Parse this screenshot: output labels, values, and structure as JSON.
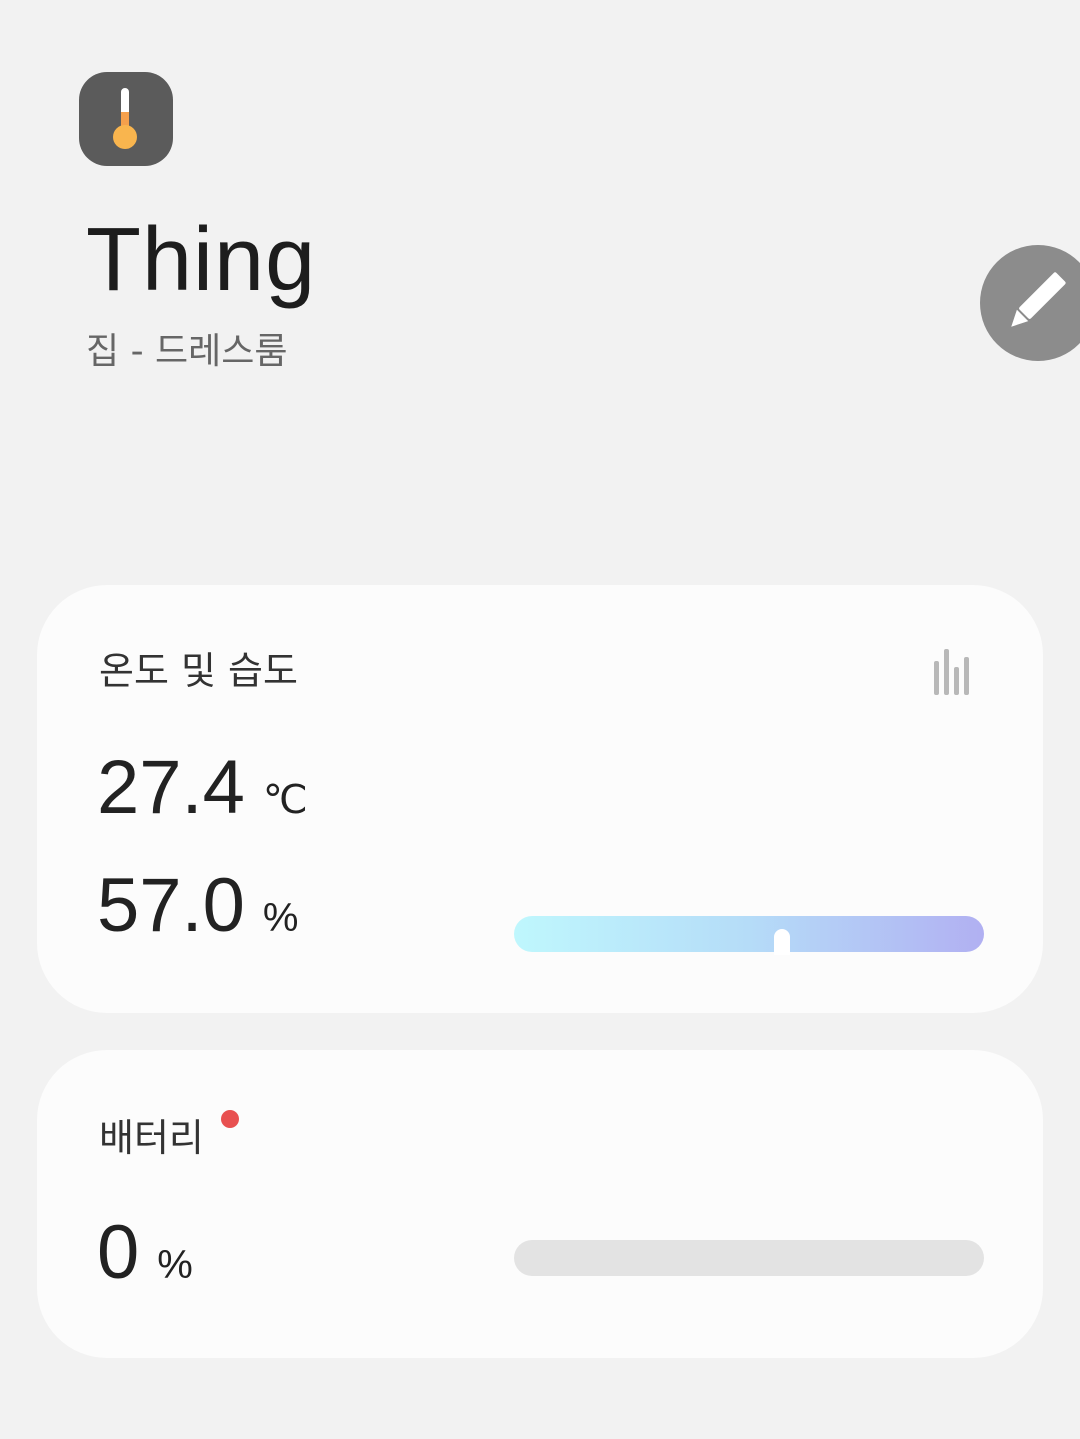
{
  "device": {
    "icon": "thermometer-icon",
    "name": "Thing",
    "location": "집 - 드레스룸",
    "edit_icon": "pencil-icon"
  },
  "temp_humidity": {
    "title": "온도 및 습도",
    "history_icon": "bar-chart-icon",
    "temperature": {
      "value": "27.4",
      "unit": "℃"
    },
    "humidity": {
      "value": "57.0",
      "unit": "%",
      "level": 0.57
    }
  },
  "battery": {
    "title": "배터리",
    "alert": true,
    "value": "0",
    "unit": "%",
    "level": 0
  },
  "colors": {
    "icon_bg": "#5b5b5b",
    "thermo_fill": "#f5a04c",
    "edit_bg": "#8c8c8c",
    "alert_dot": "#e85050",
    "battery_track": "#e3e3e3"
  }
}
